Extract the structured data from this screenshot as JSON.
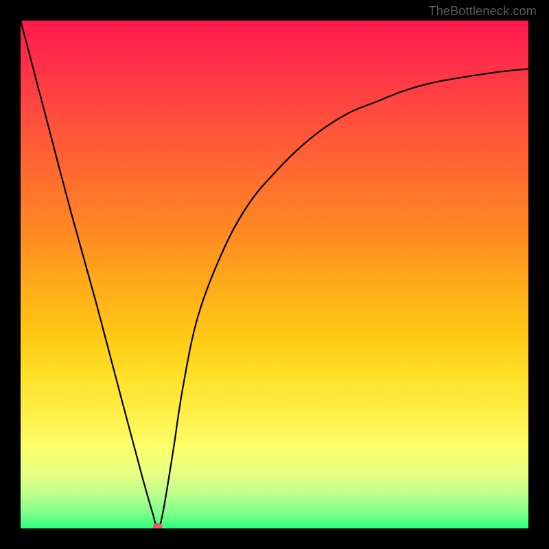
{
  "watermark": "TheBottleneck.com",
  "chart_data": {
    "type": "line",
    "title": "",
    "xlabel": "",
    "ylabel": "",
    "xlim": [
      0,
      100
    ],
    "ylim": [
      0,
      100
    ],
    "grid": false,
    "legend": false,
    "gradient_stops": [
      {
        "pos": 0,
        "color": "#ff1a4d"
      },
      {
        "pos": 30,
        "color": "#ff6a30"
      },
      {
        "pos": 62,
        "color": "#ffc814"
      },
      {
        "pos": 84,
        "color": "#fbff6a"
      },
      {
        "pos": 100,
        "color": "#2eff7a"
      }
    ],
    "series": [
      {
        "name": "bottleneck-curve",
        "x": [
          0,
          5,
          10,
          15,
          20,
          24,
          26,
          27,
          28,
          30,
          32,
          35,
          40,
          45,
          50,
          55,
          60,
          65,
          70,
          75,
          80,
          85,
          90,
          95,
          100
        ],
        "values": [
          100,
          81,
          62,
          44,
          25,
          10,
          3,
          0,
          3,
          15,
          28,
          42,
          55,
          64,
          70,
          75,
          79,
          82,
          84,
          86,
          87.5,
          88.5,
          89.3,
          90,
          90.5
        ]
      }
    ],
    "marker": {
      "x": 27,
      "y": 0,
      "color": "#e06070"
    }
  }
}
